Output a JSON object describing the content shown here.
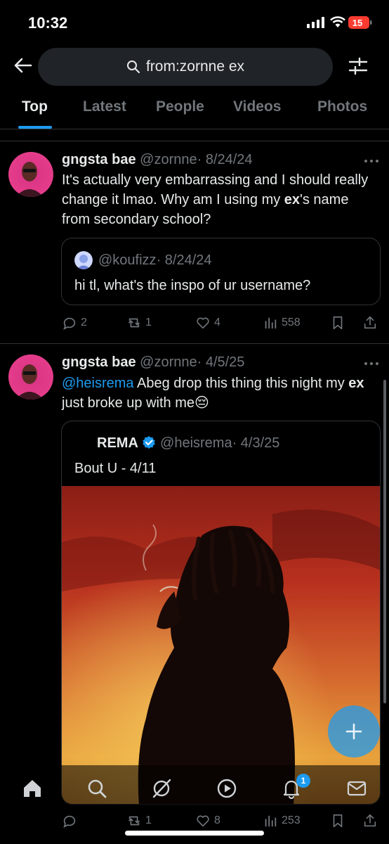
{
  "status": {
    "time": "10:32",
    "battery": "15"
  },
  "search": {
    "query": "from:zornne ex"
  },
  "tabs": [
    {
      "label": "Top"
    },
    {
      "label": "Latest"
    },
    {
      "label": "People"
    },
    {
      "label": "Videos"
    },
    {
      "label": "Photos"
    }
  ],
  "tweets": [
    {
      "name": "gngsta bae",
      "handle": "@zornne",
      "date": "· 8/24/24",
      "text_parts": [
        "It's actually very embarrassing and I should really change it lmao. Why am I using my ",
        "ex",
        "'s name from secondary school?"
      ],
      "quote": {
        "handle": "@koufizz",
        "date": "· 8/24/24",
        "text": "hi tl, what's the inspo of ur username?"
      },
      "replies": "2",
      "retweets": "1",
      "likes": "4",
      "views": "558"
    },
    {
      "name": "gngsta bae",
      "handle": "@zornne",
      "date": "· 4/5/25",
      "mention": "@heisrema",
      "text_parts": [
        " Abeg drop this thing this night my ",
        "ex",
        " just broke up with me😔"
      ],
      "quote": {
        "name": "REMA",
        "handle": "@heisrema",
        "date": "· 4/3/25",
        "text": "Bout U - 4/11"
      },
      "replies": "",
      "retweets": "1",
      "likes": "8",
      "views": "253"
    }
  ],
  "nav": {
    "notifications_badge": "1"
  },
  "colors": {
    "accent": "#1d9bf0",
    "background": "#000000",
    "muted": "#71767b"
  }
}
